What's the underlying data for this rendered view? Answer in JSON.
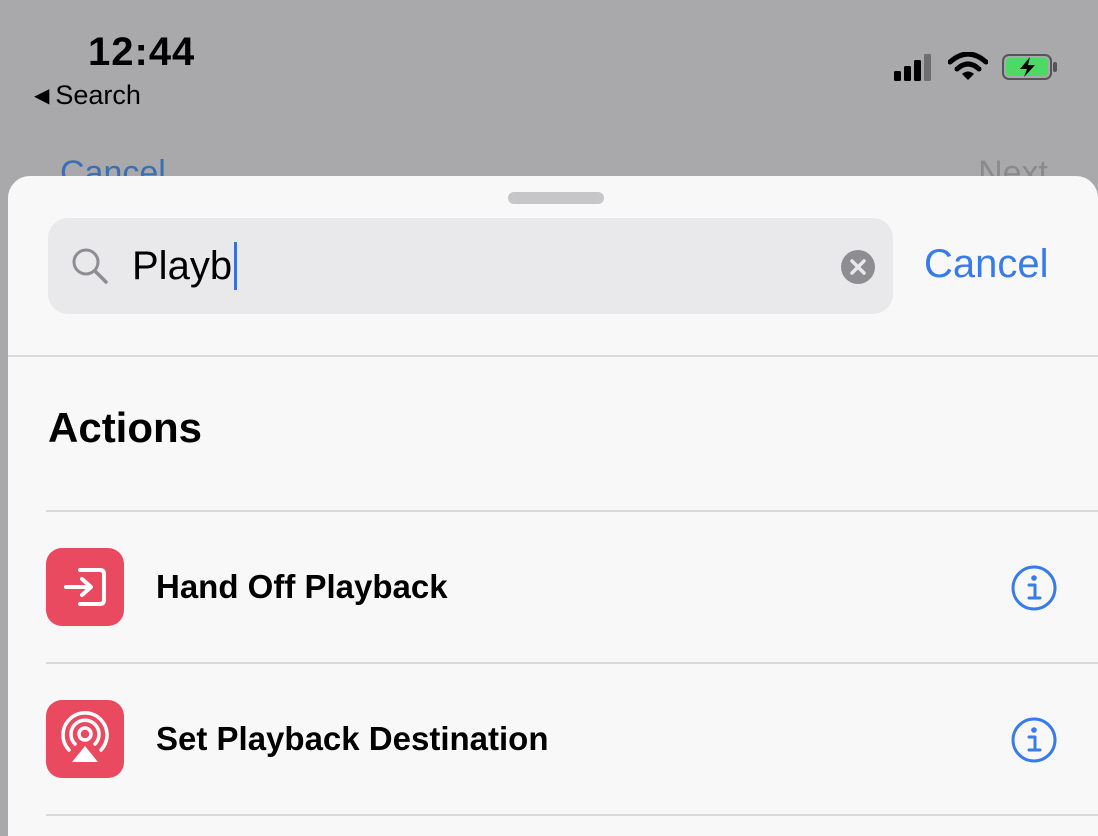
{
  "status_bar": {
    "time": "12:44",
    "back_label": "Search"
  },
  "behind": {
    "cancel_label": "Cancel",
    "next_label": "Next"
  },
  "search": {
    "value": "Playb",
    "cancel_label": "Cancel"
  },
  "section": {
    "title": "Actions"
  },
  "actions": [
    {
      "label": "Hand Off Playback",
      "icon": "handoff-icon"
    },
    {
      "label": "Set Playback Destination",
      "icon": "airplay-audio-icon"
    }
  ],
  "colors": {
    "accent": "#3a7bea",
    "action_icon_bg": "#ea4a5f",
    "battery_fill": "#4cd964"
  }
}
